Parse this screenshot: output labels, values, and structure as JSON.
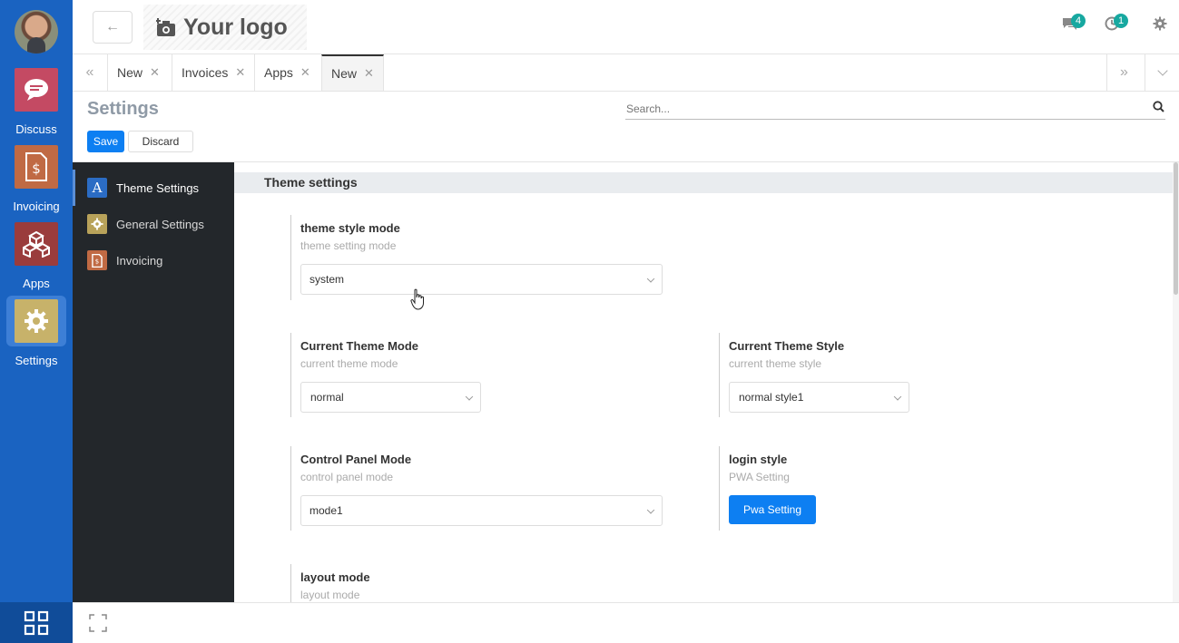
{
  "rail": {
    "items": [
      {
        "label": "Discuss",
        "icon": "chat-bubble-icon",
        "color": "#c44a63"
      },
      {
        "label": "Invoicing",
        "icon": "invoice-icon",
        "color": "#c06a44"
      },
      {
        "label": "Apps",
        "icon": "cubes-icon",
        "color": "#9a3c3c"
      },
      {
        "label": "Settings",
        "icon": "gear-icon",
        "color": "#c7b26a"
      }
    ],
    "active": "Settings"
  },
  "topbar": {
    "logo_text": "Your logo",
    "messages_count": "4",
    "activities_count": "1"
  },
  "tabs": [
    {
      "label": "New"
    },
    {
      "label": "Invoices"
    },
    {
      "label": "Apps"
    },
    {
      "label": "New",
      "active": true
    }
  ],
  "page": {
    "title": "Settings",
    "save_label": "Save",
    "discard_label": "Discard",
    "search_placeholder": "Search..."
  },
  "side_menu": [
    {
      "label": "Theme Settings",
      "icon": "theme-a-icon",
      "color": "#2b6cc4",
      "active": true
    },
    {
      "label": "General Settings",
      "icon": "gear-icon",
      "color": "#b8a25a"
    },
    {
      "label": "Invoicing",
      "icon": "invoice-icon",
      "color": "#c06a44"
    }
  ],
  "section": {
    "title": "Theme settings",
    "fields": {
      "theme_style_mode": {
        "label": "theme style mode",
        "desc": "theme setting mode",
        "value": "system"
      },
      "current_theme_mode": {
        "label": "Current Theme Mode",
        "desc": "current theme mode",
        "value": "normal"
      },
      "current_theme_style": {
        "label": "Current Theme Style",
        "desc": "current theme style",
        "value": "normal style1"
      },
      "control_panel_mode": {
        "label": "Control Panel Mode",
        "desc": "control panel mode",
        "value": "mode1"
      },
      "login_style": {
        "label": "login style",
        "desc": "PWA Setting",
        "button": "Pwa Setting"
      },
      "layout_mode": {
        "label": "layout mode",
        "desc": "layout mode"
      }
    }
  }
}
